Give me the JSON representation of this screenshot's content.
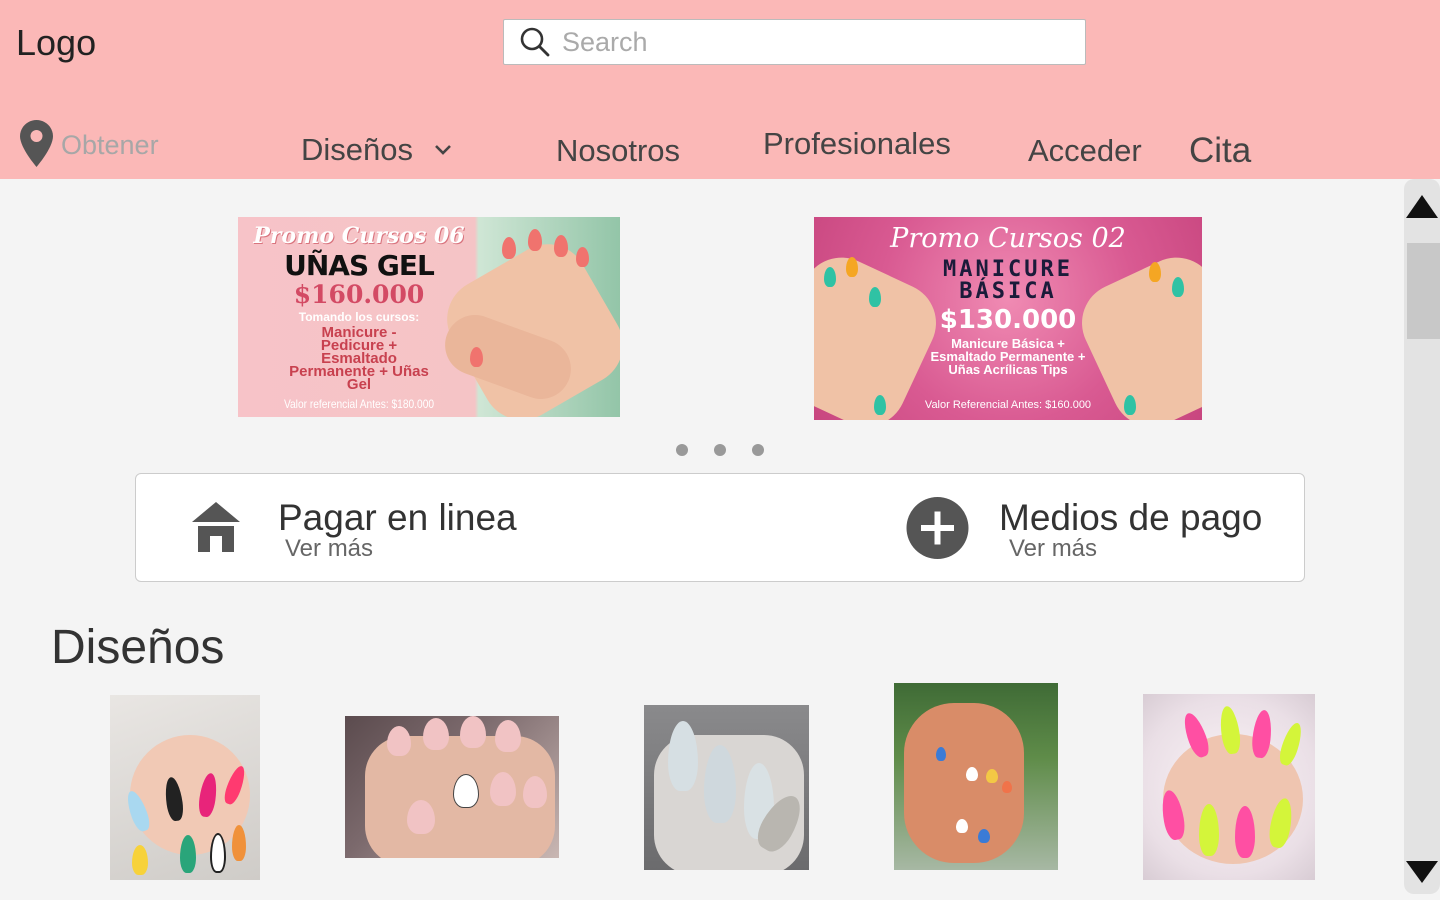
{
  "header": {
    "logo": "Logo",
    "search_placeholder": "Search",
    "location_label": "Obtener",
    "nav": {
      "disenos": "Diseños",
      "nosotros": "Nosotros",
      "profesionales": "Profesionales",
      "acceder": "Acceder",
      "cita": "Cita"
    },
    "bg_color": "#fbb8b7"
  },
  "banners": [
    {
      "line1": "Promo Cursos 06",
      "line2": "UÑAS GEL",
      "price": "$160.000",
      "line4": "Tomando los cursos:",
      "details": "Manicure - Pedicure + Esmaltado Permanente + Uñas Gel",
      "footer": "Valor referencial Antes: $180.000"
    },
    {
      "line1": "Promo Cursos 02",
      "line2": "MANICURE BÁSICA",
      "price": "$130.000",
      "details": "Manicure Básica + Esmaltado Permanente + Uñas Acrílicas Tips",
      "footer": "Valor Referencial Antes: $160.000"
    }
  ],
  "carousel": {
    "dot_count": 3
  },
  "payments": {
    "online": {
      "title": "Pagar en linea",
      "link": "Ver más"
    },
    "methods": {
      "title": "Medios de pago",
      "link": "Ver más"
    }
  },
  "designs": {
    "title": "Diseños"
  }
}
